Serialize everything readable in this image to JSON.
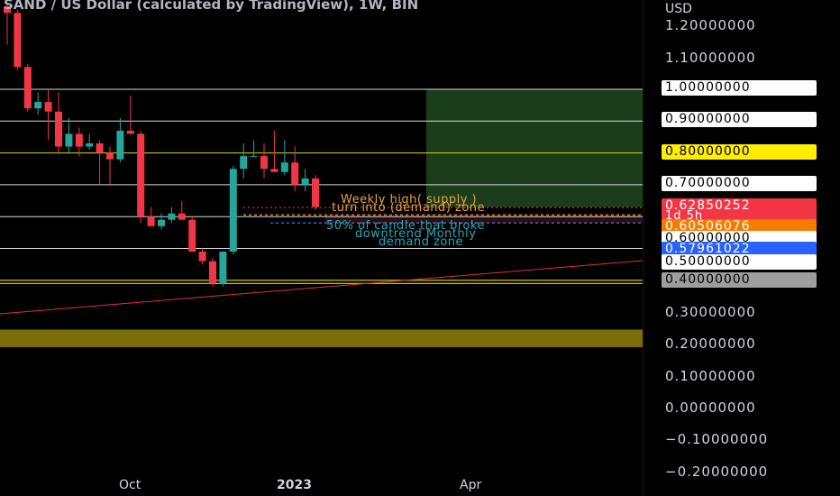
{
  "title": "SAND / US Dollar (calculated by TradingView), 1W, BIN",
  "axis_unit": "USD",
  "chart_data": {
    "type": "candlestick",
    "x_labels": [
      "Oct",
      "2023",
      "Apr"
    ],
    "y_ticks": [
      "1.20000000",
      "1.10000000",
      "1.00000000",
      "0.90000000",
      "0.80000000",
      "0.70000000",
      "0.60000000",
      "0.50000000",
      "0.40000000",
      "0.30000000",
      "0.20000000",
      "0.10000000",
      "0.00000000",
      "−0.10000000",
      "−0.20000000"
    ],
    "ylim": [
      -0.22,
      1.27
    ],
    "candles": [
      [
        1.26,
        1.27,
        1.14,
        1.24
      ],
      [
        1.24,
        1.25,
        1.06,
        1.07
      ],
      [
        1.07,
        1.08,
        0.93,
        0.94
      ],
      [
        0.94,
        0.99,
        0.92,
        0.96
      ],
      [
        0.96,
        1.0,
        0.84,
        0.93
      ],
      [
        0.93,
        0.99,
        0.8,
        0.82
      ],
      [
        0.82,
        0.91,
        0.8,
        0.86
      ],
      [
        0.86,
        0.88,
        0.79,
        0.82
      ],
      [
        0.82,
        0.86,
        0.81,
        0.83
      ],
      [
        0.83,
        0.84,
        0.7,
        0.8
      ],
      [
        0.8,
        0.82,
        0.7,
        0.78
      ],
      [
        0.78,
        0.91,
        0.77,
        0.87
      ],
      [
        0.87,
        0.98,
        0.86,
        0.86
      ],
      [
        0.86,
        0.87,
        0.58,
        0.6
      ],
      [
        0.6,
        0.63,
        0.57,
        0.57
      ],
      [
        0.57,
        0.61,
        0.56,
        0.59
      ],
      [
        0.59,
        0.63,
        0.58,
        0.61
      ],
      [
        0.61,
        0.65,
        0.59,
        0.59
      ],
      [
        0.59,
        0.6,
        0.49,
        0.49
      ],
      [
        0.49,
        0.5,
        0.45,
        0.46
      ],
      [
        0.46,
        0.47,
        0.38,
        0.39
      ],
      [
        0.39,
        0.49,
        0.38,
        0.49
      ],
      [
        0.49,
        0.76,
        0.48,
        0.75
      ],
      [
        0.75,
        0.83,
        0.72,
        0.79
      ],
      [
        0.79,
        0.84,
        0.79,
        0.79
      ],
      [
        0.79,
        0.83,
        0.72,
        0.75
      ],
      [
        0.75,
        0.87,
        0.74,
        0.74
      ],
      [
        0.74,
        0.84,
        0.73,
        0.77
      ],
      [
        0.77,
        0.82,
        0.68,
        0.7
      ],
      [
        0.7,
        0.75,
        0.68,
        0.72
      ],
      [
        0.72,
        0.73,
        0.62,
        0.63
      ]
    ],
    "levels": [
      "1.00000000",
      "0.90000000",
      "0.80000000",
      "0.70000000",
      "0.60000000",
      "0.50000000",
      "0.40000000"
    ],
    "price_labels": {
      "current": "0.62850252",
      "countdown": "1d 5h",
      "orange": "0.60506076",
      "blue": "0.57961022"
    },
    "annotations": {
      "supply_1": "Weekly high( supply )",
      "supply_2": "turn into (demand) zone",
      "demand_1": "50% of candle that broke",
      "demand_2": "downtrend Monthly",
      "demand_3": "demand zone"
    },
    "colors": {
      "up": "#26a69a",
      "down": "#f23645",
      "current_label": "#f23645",
      "orange_label": "#f57c00",
      "blue_label": "#2962ff",
      "yellow_label": "#ffee00",
      "grey_label": "#9e9e9e",
      "target_zone": "#1b3d1b",
      "yellow_zone": "#7a6e0a"
    }
  }
}
